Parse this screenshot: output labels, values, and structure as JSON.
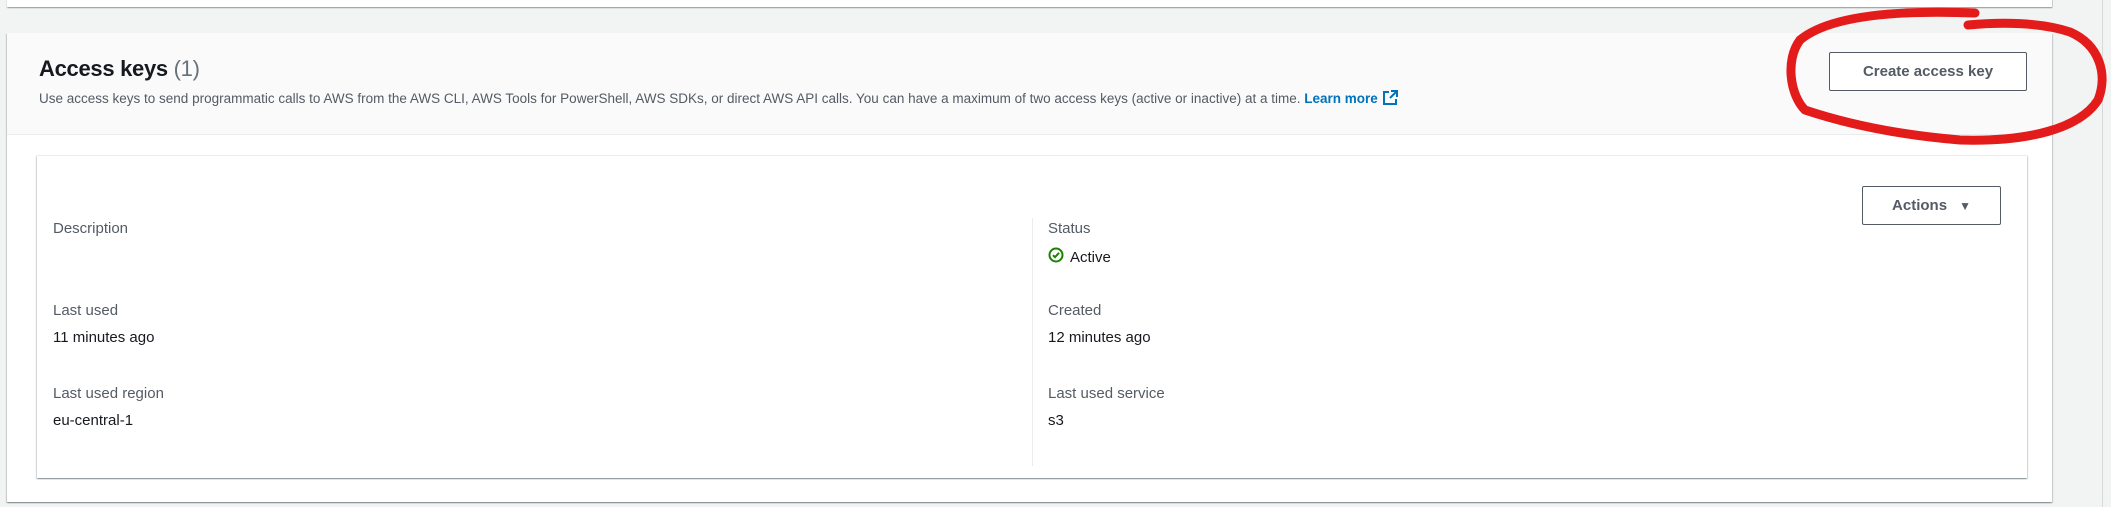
{
  "section": {
    "title": "Access keys",
    "count": "(1)",
    "description": "Use access keys to send programmatic calls to AWS from the AWS CLI, AWS Tools for PowerShell, AWS SDKs, or direct AWS API calls. You can have a maximum of two access keys (active or inactive) at a time.",
    "learn_more": "Learn more",
    "create_button": "Create access key"
  },
  "key": {
    "actions_button": "Actions",
    "fields": {
      "description": {
        "label": "Description",
        "value": ""
      },
      "status": {
        "label": "Status",
        "value": "Active"
      },
      "last_used": {
        "label": "Last used",
        "value": "11 minutes ago"
      },
      "created": {
        "label": "Created",
        "value": "12 minutes ago"
      },
      "last_used_region": {
        "label": "Last used region",
        "value": "eu-central-1"
      },
      "last_used_service": {
        "label": "Last used service",
        "value": "s3"
      }
    }
  },
  "colors": {
    "status_active": "#1d8102",
    "link": "#0073bb",
    "annotation": "#e31b1b"
  }
}
